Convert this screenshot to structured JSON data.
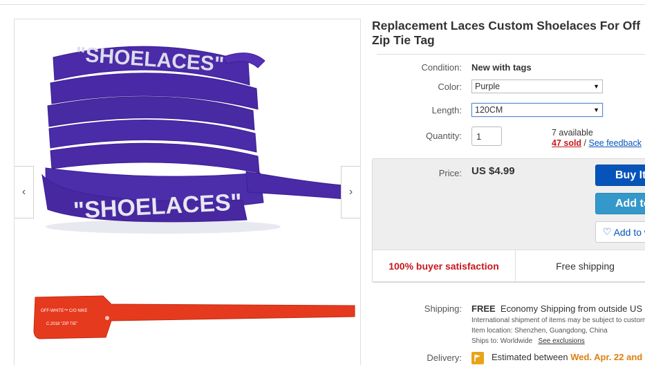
{
  "listing": {
    "title": "Replacement Laces Custom Shoelaces For Off Zip Tie Tag",
    "image_text_1": "\"SHOELACES\"",
    "image_text_2": "\"SHOELACES\"",
    "tag_text_1": "OFF-WHITE™ C/O NIKE",
    "tag_text_2": "C.2018 \"ZIP TIE\""
  },
  "gallery": {
    "prev_icon": "‹",
    "next_icon": "›"
  },
  "condition": {
    "label": "Condition:",
    "value": "New with tags"
  },
  "color": {
    "label": "Color:",
    "selected": "Purple"
  },
  "length": {
    "label": "Length:",
    "selected": "120CM"
  },
  "quantity": {
    "label": "Quantity:",
    "value": "1",
    "available": "7 available",
    "sold": "47 sold",
    "separator": " / ",
    "feedback": "See feedback"
  },
  "price": {
    "label": "Price:",
    "value": "US $4.99"
  },
  "buttons": {
    "buy": "Buy It Now",
    "cart": "Add to cart",
    "watch": "Add to watchlist"
  },
  "badges": {
    "satisfaction": "100% buyer satisfaction",
    "shipping": "Free shipping"
  },
  "shipping": {
    "label": "Shipping:",
    "free": "FREE",
    "method": "Economy Shipping from outside US",
    "intl_note": "International shipment of items may be subject to customs",
    "location": "Item location:  Shenzhen, Guangdong, China",
    "ships_to_label": "Ships to:  Worldwide",
    "exclusions": "See exclusions"
  },
  "delivery": {
    "label": "Delivery:",
    "prefix": "Estimated between ",
    "date": "Wed. Apr. 22 and"
  },
  "colors": {
    "purple_lace": "#4a2aa6",
    "tag_red": "#e53a1e",
    "buy_blue": "#0654ba",
    "cart_blue": "#3498ca",
    "sold_red": "#c7161d"
  }
}
